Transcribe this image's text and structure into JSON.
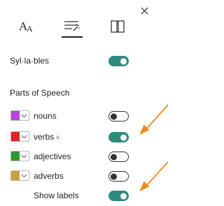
{
  "tabs": [
    {
      "name": "text-options",
      "glyph": "A"
    },
    {
      "name": "grammar-options"
    },
    {
      "name": "reading-preferences"
    }
  ],
  "syllables": {
    "label": "Syl·la·bles",
    "on": true
  },
  "parts_of_speech": {
    "title": "Parts of Speech",
    "items": [
      {
        "label": "nouns",
        "color": "#b646d6",
        "on": false
      },
      {
        "label": "verbs",
        "marker": "v.",
        "color": "#d92626",
        "on": true
      },
      {
        "label": "adjectives",
        "color": "#2e9a2e",
        "on": false
      },
      {
        "label": "adverbs",
        "color": "#c9a23a",
        "on": false
      }
    ],
    "show_labels": {
      "label": "Show labels",
      "on": true
    }
  },
  "colors": {
    "accent": "#2e8b7e",
    "arrow": "#f28a1e"
  }
}
